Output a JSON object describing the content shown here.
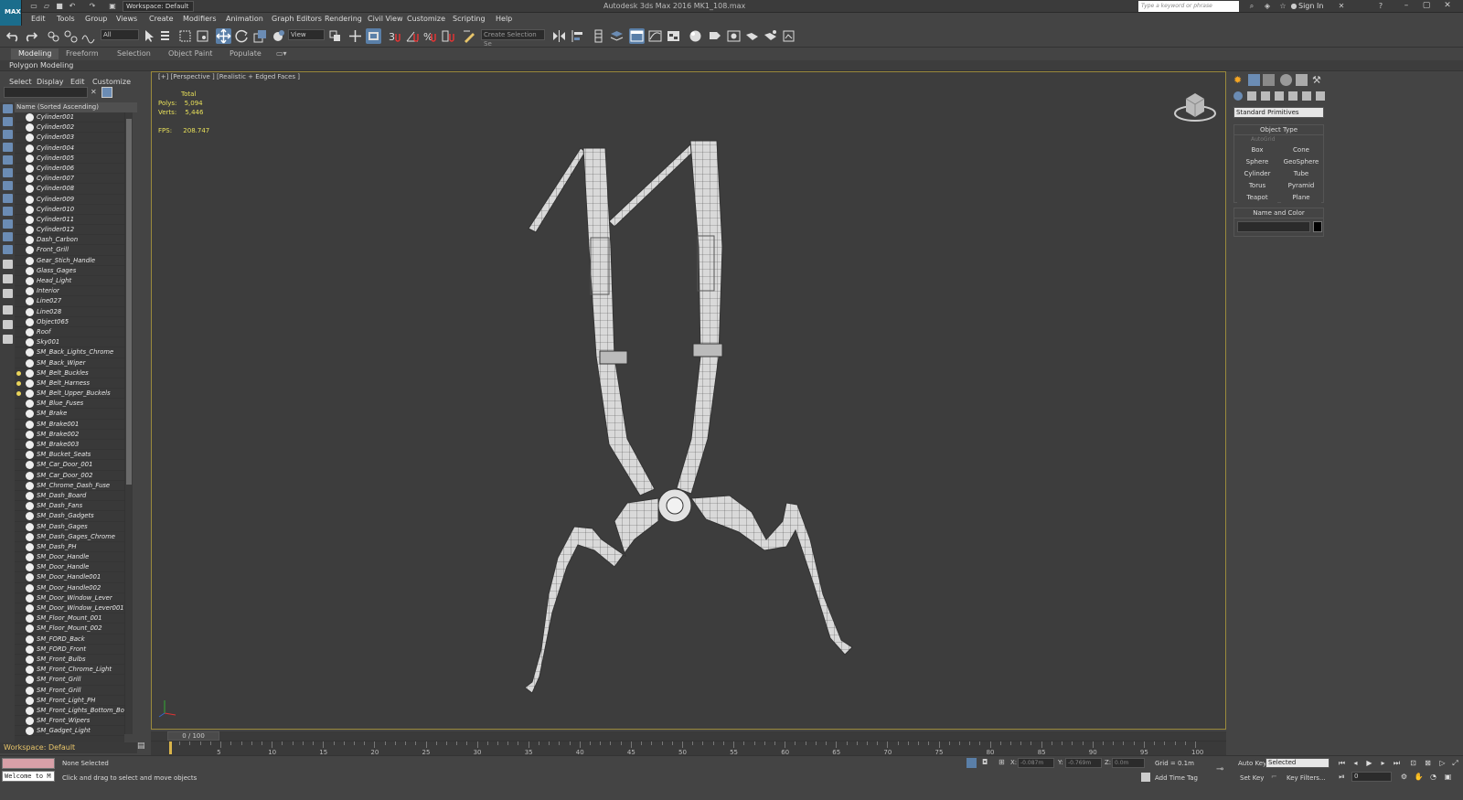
{
  "titlebar": {
    "app_logo": "MAX",
    "workspace": "Workspace: Default",
    "title": "Autodesk 3ds Max 2016    MK1_108.max",
    "search_placeholder": "Type a keyword or phrase",
    "sign_in": "Sign In"
  },
  "menu": [
    "Edit",
    "Tools",
    "Group",
    "Views",
    "Create",
    "Modifiers",
    "Animation",
    "Graph Editors",
    "Rendering",
    "Civil View",
    "Customize",
    "Scripting",
    "Help"
  ],
  "toolbar": {
    "selection_filter": "All",
    "ref_coord": "View",
    "named_selection": "Create Selection Se"
  },
  "ribbon": {
    "tabs": [
      "Modeling",
      "Freeform",
      "Selection",
      "Object Paint",
      "Populate"
    ],
    "active_tab": "Modeling",
    "panel": "Polygon Modeling"
  },
  "scene_explorer": {
    "menu": [
      "Select",
      "Display",
      "Edit",
      "Customize"
    ],
    "column_header": "Name (Sorted Ascending)",
    "items": [
      {
        "name": "Cylinder001",
        "light": false
      },
      {
        "name": "Cylinder002",
        "light": false
      },
      {
        "name": "Cylinder003",
        "light": false
      },
      {
        "name": "Cylinder004",
        "light": false
      },
      {
        "name": "Cylinder005",
        "light": false
      },
      {
        "name": "Cylinder006",
        "light": false
      },
      {
        "name": "Cylinder007",
        "light": false
      },
      {
        "name": "Cylinder008",
        "light": false
      },
      {
        "name": "Cylinder009",
        "light": false
      },
      {
        "name": "Cylinder010",
        "light": false
      },
      {
        "name": "Cylinder011",
        "light": false
      },
      {
        "name": "Cylinder012",
        "light": false
      },
      {
        "name": "Dash_Carbon",
        "light": false
      },
      {
        "name": "Front_Grill",
        "light": false
      },
      {
        "name": "Gear_Stich_Handle",
        "light": false
      },
      {
        "name": "Glass_Gages",
        "light": false
      },
      {
        "name": "Head_Light",
        "light": false
      },
      {
        "name": "Interior",
        "light": false
      },
      {
        "name": "Line027",
        "light": false
      },
      {
        "name": "Line028",
        "light": false
      },
      {
        "name": "Object065",
        "light": false
      },
      {
        "name": "Roof",
        "light": false
      },
      {
        "name": "Sky001",
        "light": false
      },
      {
        "name": "SM_Back_Lights_Chrome",
        "light": false
      },
      {
        "name": "SM_Back_Wiper",
        "light": false
      },
      {
        "name": "SM_Belt_Buckles",
        "light": true
      },
      {
        "name": "SM_Belt_Harness",
        "light": true
      },
      {
        "name": "SM_Belt_Upper_Buckels",
        "light": true
      },
      {
        "name": "SM_Blue_Fuses",
        "light": false
      },
      {
        "name": "SM_Brake",
        "light": false
      },
      {
        "name": "SM_Brake001",
        "light": false
      },
      {
        "name": "SM_Brake002",
        "light": false
      },
      {
        "name": "SM_Brake003",
        "light": false
      },
      {
        "name": "SM_Bucket_Seats",
        "light": false
      },
      {
        "name": "SM_Car_Door_001",
        "light": false
      },
      {
        "name": "SM_Car_Door_002",
        "light": false
      },
      {
        "name": "SM_Chrome_Dash_Fuse",
        "light": false
      },
      {
        "name": "SM_Dash_Board",
        "light": false
      },
      {
        "name": "SM_Dash_Fans",
        "light": false
      },
      {
        "name": "SM_Dash_Gadgets",
        "light": false
      },
      {
        "name": "SM_Dash_Gages",
        "light": false
      },
      {
        "name": "SM_Dash_Gages_Chrome",
        "light": false
      },
      {
        "name": "SM_Dash_PH",
        "light": false
      },
      {
        "name": "SM_Door_Handle",
        "light": false
      },
      {
        "name": "SM_Door_Handle",
        "light": false
      },
      {
        "name": "SM_Door_Handle001",
        "light": false
      },
      {
        "name": "SM_Door_Handle002",
        "light": false
      },
      {
        "name": "SM_Door_Window_Lever",
        "light": false
      },
      {
        "name": "SM_Door_Window_Lever001",
        "light": false
      },
      {
        "name": "SM_Floor_Mount_001",
        "light": false
      },
      {
        "name": "SM_Floor_Mount_002",
        "light": false
      },
      {
        "name": "SM_FORD_Back",
        "light": false
      },
      {
        "name": "SM_FORD_Front",
        "light": false
      },
      {
        "name": "SM_Front_Bulbs",
        "light": false
      },
      {
        "name": "SM_Front_Chrome_Light",
        "light": false
      },
      {
        "name": "SM_Front_Grill",
        "light": false
      },
      {
        "name": "SM_Front_Grill",
        "light": false
      },
      {
        "name": "SM_Front_Light_PH",
        "light": false
      },
      {
        "name": "SM_Front_Lights_Bottom_Bo",
        "light": false
      },
      {
        "name": "SM_Front_Wipers",
        "light": false
      },
      {
        "name": "SM_Gadget_Light",
        "light": false
      }
    ],
    "footer": "Workspace: Default"
  },
  "viewport": {
    "label": "[+] [Perspective ] [Realistic + Edged Faces ]",
    "stats_total": "Total",
    "polys_label": "Polys:",
    "polys": "5,094",
    "verts_label": "Verts:",
    "verts": "5,446",
    "fps_label": "FPS:",
    "fps": "208.747"
  },
  "command_panel": {
    "primitive_type": "Standard Primitives",
    "object_type_title": "Object Type",
    "autogrid": "AutoGrid",
    "buttons": [
      "Box",
      "Cone",
      "Sphere",
      "GeoSphere",
      "Cylinder",
      "Tube",
      "Torus",
      "Pyramid",
      "Teapot",
      "Plane"
    ],
    "name_color_title": "Name and Color"
  },
  "timeline": {
    "slider": "0 / 100",
    "ticks": [
      "5",
      "10",
      "15",
      "20",
      "25",
      "30",
      "35",
      "40",
      "45",
      "50",
      "55",
      "60",
      "65",
      "70",
      "75",
      "80",
      "85",
      "90",
      "95",
      "100"
    ]
  },
  "status": {
    "maxscript": "Welcome to M",
    "selection": "None Selected",
    "prompt": "Click and drag to select and move objects",
    "x_label": "X:",
    "x_value": "-0.087m",
    "y_label": "Y:",
    "y_value": "-0.769m",
    "z_label": "Z:",
    "z_value": "0.0m",
    "grid": "Grid = 0.1m",
    "add_time_tag": "Add Time Tag",
    "auto_key": "Auto Key",
    "set_key": "Set Key",
    "selected": "Selected",
    "key_filters": "Key Filters...",
    "frame": "0"
  }
}
